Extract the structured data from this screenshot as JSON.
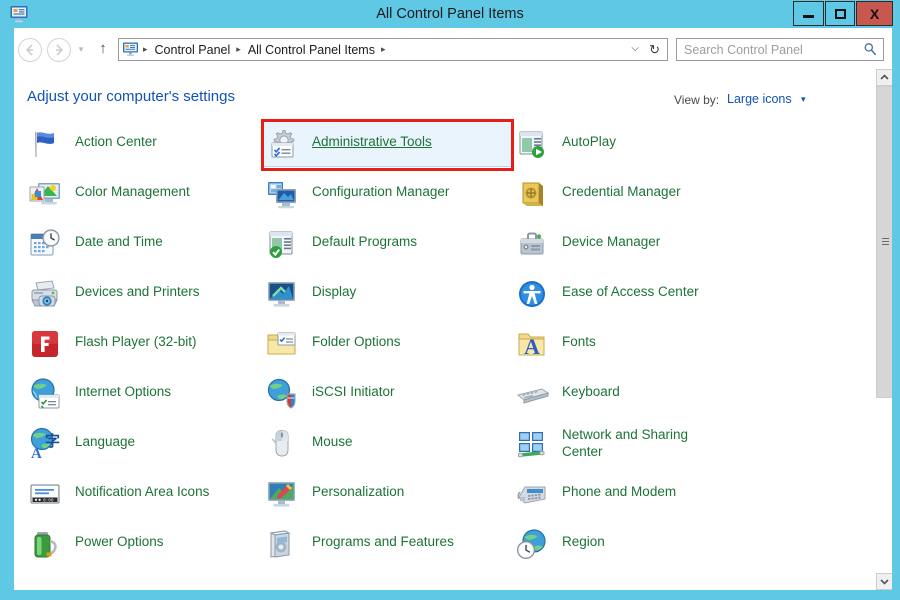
{
  "window": {
    "title": "All Control Panel Items",
    "icon": "control-panel-icon",
    "controls": {
      "minimize": "–",
      "maximize": "□",
      "close": "X"
    },
    "titlebar_color": "#5ec8e5",
    "close_color": "#c8584f"
  },
  "nav": {
    "back": "←",
    "forward": "→",
    "recent": "▾",
    "up": "↑",
    "breadcrumb": [
      "Control Panel",
      "All Control Panel Items"
    ],
    "separator": "▸",
    "dropdown": "⌵",
    "refresh": "↻"
  },
  "search": {
    "placeholder": "Search Control Panel",
    "icon": "search-icon"
  },
  "header": {
    "title": "Adjust your computer's settings",
    "viewby_label": "View by:",
    "viewby_value": "Large icons",
    "viewby_caret": "▾",
    "title_color": "#1053b5"
  },
  "highlight": {
    "target": "Administrative Tools",
    "box_color": "#e71d18",
    "hover_bg": "#eaf4fc"
  },
  "scrollbar": {
    "up_arrow": "▲",
    "down_arrow": "▼",
    "thumb_top_pct": 3,
    "thumb_height_pct": 60
  },
  "items": [
    {
      "label": "Action Center",
      "icon": "flag-icon",
      "col": 0,
      "row": 0,
      "wrap": false,
      "hovered": false
    },
    {
      "label": "Color Management",
      "icon": "color-profile-icon",
      "col": 0,
      "row": 1,
      "wrap": false,
      "hovered": false
    },
    {
      "label": "Date and Time",
      "icon": "calendar-clock-icon",
      "col": 0,
      "row": 2,
      "wrap": false,
      "hovered": false
    },
    {
      "label": "Devices and Printers",
      "icon": "printer-icon",
      "col": 0,
      "row": 3,
      "wrap": false,
      "hovered": false
    },
    {
      "label": "Flash Player (32-bit)",
      "icon": "flash-player-icon",
      "col": 0,
      "row": 4,
      "wrap": false,
      "hovered": false
    },
    {
      "label": "Internet Options",
      "icon": "globe-options-icon",
      "col": 0,
      "row": 5,
      "wrap": false,
      "hovered": false
    },
    {
      "label": "Language",
      "icon": "language-globe-icon",
      "col": 0,
      "row": 6,
      "wrap": false,
      "hovered": false
    },
    {
      "label": "Notification Area Icons",
      "icon": "taskbar-icon",
      "col": 0,
      "row": 7,
      "wrap": false,
      "hovered": false
    },
    {
      "label": "Power Options",
      "icon": "battery-icon",
      "col": 0,
      "row": 8,
      "wrap": false,
      "hovered": false
    },
    {
      "label": "Administrative Tools",
      "icon": "gear-tools-icon",
      "col": 1,
      "row": 0,
      "wrap": false,
      "hovered": true
    },
    {
      "label": "Configuration Manager",
      "icon": "config-manager-icon",
      "col": 1,
      "row": 1,
      "wrap": false,
      "hovered": false
    },
    {
      "label": "Default Programs",
      "icon": "default-programs-icon",
      "col": 1,
      "row": 2,
      "wrap": false,
      "hovered": false
    },
    {
      "label": "Display",
      "icon": "monitor-icon",
      "col": 1,
      "row": 3,
      "wrap": false,
      "hovered": false
    },
    {
      "label": "Folder Options",
      "icon": "folder-options-icon",
      "col": 1,
      "row": 4,
      "wrap": false,
      "hovered": false
    },
    {
      "label": "iSCSI Initiator",
      "icon": "iscsi-shield-icon",
      "col": 1,
      "row": 5,
      "wrap": false,
      "hovered": false
    },
    {
      "label": "Mouse",
      "icon": "mouse-icon",
      "col": 1,
      "row": 6,
      "wrap": false,
      "hovered": false
    },
    {
      "label": "Personalization",
      "icon": "personalization-icon",
      "col": 1,
      "row": 7,
      "wrap": false,
      "hovered": false
    },
    {
      "label": "Programs and Features",
      "icon": "programs-features-icon",
      "col": 1,
      "row": 8,
      "wrap": false,
      "hovered": false
    },
    {
      "label": "AutoPlay",
      "icon": "autoplay-icon",
      "col": 2,
      "row": 0,
      "wrap": false,
      "hovered": false
    },
    {
      "label": "Credential Manager",
      "icon": "vault-icon",
      "col": 2,
      "row": 1,
      "wrap": false,
      "hovered": false
    },
    {
      "label": "Device Manager",
      "icon": "device-manager-icon",
      "col": 2,
      "row": 2,
      "wrap": false,
      "hovered": false
    },
    {
      "label": "Ease of Access Center",
      "icon": "ease-of-access-icon",
      "col": 2,
      "row": 3,
      "wrap": false,
      "hovered": false
    },
    {
      "label": "Fonts",
      "icon": "fonts-folder-icon",
      "col": 2,
      "row": 4,
      "wrap": false,
      "hovered": false
    },
    {
      "label": "Keyboard",
      "icon": "keyboard-icon",
      "col": 2,
      "row": 5,
      "wrap": false,
      "hovered": false
    },
    {
      "label": "Network and Sharing Center",
      "icon": "network-sharing-icon",
      "col": 2,
      "row": 6,
      "wrap": true,
      "hovered": false
    },
    {
      "label": "Phone and Modem",
      "icon": "phone-modem-icon",
      "col": 2,
      "row": 7,
      "wrap": false,
      "hovered": false
    },
    {
      "label": "Region",
      "icon": "region-globe-icon",
      "col": 2,
      "row": 8,
      "wrap": false,
      "hovered": false
    }
  ]
}
